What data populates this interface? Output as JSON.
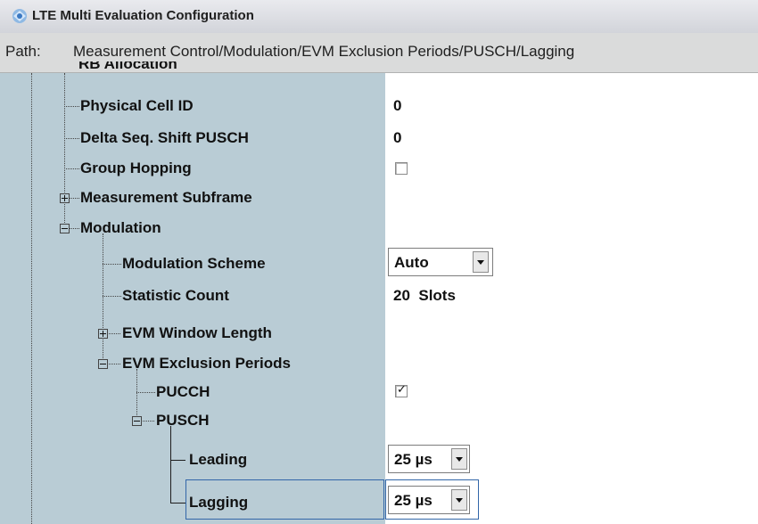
{
  "window": {
    "title": "LTE Multi Evaluation Configuration"
  },
  "path": {
    "label": "Path:",
    "value": "Measurement Control/Modulation/EVM Exclusion Periods/PUSCH/Lagging"
  },
  "tree": {
    "top_partial": "RB Allocation",
    "physical_cell_id": {
      "label": "Physical Cell ID",
      "value": "0"
    },
    "delta_seq_shift": {
      "label": "Delta Seq. Shift PUSCH",
      "value": "0"
    },
    "group_hopping": {
      "label": "Group Hopping",
      "checked": false
    },
    "measurement_subframe": {
      "label": "Measurement Subframe",
      "expanded": false
    },
    "modulation": {
      "label": "Modulation",
      "expanded": true
    },
    "modulation_scheme": {
      "label": "Modulation Scheme",
      "value": "Auto"
    },
    "statistic_count": {
      "label": "Statistic Count",
      "value": "20  Slots"
    },
    "evm_window_length": {
      "label": "EVM Window Length",
      "expanded": false
    },
    "evm_exclusion_periods": {
      "label": "EVM Exclusion Periods",
      "expanded": true
    },
    "pucch": {
      "label": "PUCCH",
      "checked": true
    },
    "pusch": {
      "label": "PUSCH",
      "expanded": true
    },
    "leading": {
      "label": "Leading",
      "value": "25 µs"
    },
    "lagging": {
      "label": "Lagging",
      "value": "25 µs",
      "selected": true
    }
  },
  "colors": {
    "tree_bg": "#b9ccd5",
    "focus": "#3266a8"
  }
}
